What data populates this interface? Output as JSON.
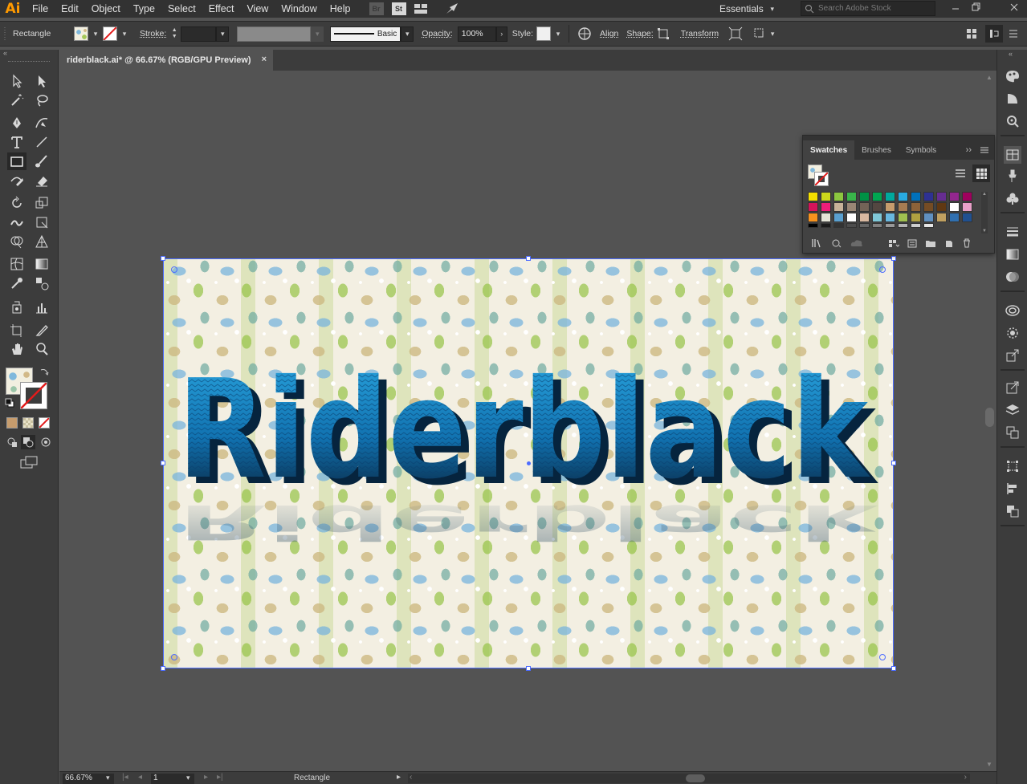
{
  "app": {
    "logo": "Ai"
  },
  "menu": [
    "File",
    "Edit",
    "Object",
    "Type",
    "Select",
    "Effect",
    "View",
    "Window",
    "Help"
  ],
  "menubar_icons": {
    "bridge": "Br",
    "stock": "St"
  },
  "workspace": {
    "label": "Essentials"
  },
  "search": {
    "placeholder": "Search Adobe Stock"
  },
  "controlbar": {
    "tool_name": "Rectangle",
    "stroke_label": "Stroke:",
    "stroke_value": "",
    "brush_label": "Basic",
    "opacity_label": "Opacity:",
    "opacity_value": "100%",
    "style_label": "Style:",
    "align_label": "Align",
    "shape_label": "Shape:",
    "transform_label": "Transform"
  },
  "document": {
    "tab_title": "riderblack.ai* @ 66.67% (RGB/GPU Preview)",
    "close": "×"
  },
  "artwork": {
    "headline": "Riderblack"
  },
  "swatches_panel": {
    "tabs": [
      "Swatches",
      "Brushes",
      "Symbols"
    ],
    "active_tab": "Swatches",
    "rows": [
      [
        "#f5e000",
        "#cdd81b",
        "#8cc63f",
        "#39b54a",
        "#009245",
        "#00a651",
        "#00a99d",
        "#29abe2",
        "#0071bc",
        "#2e3192",
        "#662d91",
        "#93278f",
        "#9e005d"
      ],
      [
        "#d4145a",
        "#ed1e79",
        "#c7b299",
        "#998675",
        "#736357",
        "#534741",
        "#c69c6d",
        "#a67c52",
        "#8c6239",
        "#754c24",
        "#603813",
        "#ffffff",
        "#e8a0c8"
      ],
      [
        "#f7931e",
        "#e5e5d8",
        "#5aa0d0",
        "#ffffff",
        "#d8b8a0",
        "#7fc8d8",
        "#68b8e0",
        "#a0c050",
        "#b0a040",
        "#6090c0",
        "#c0a060",
        "#3070b0",
        "#205090"
      ],
      [
        "#000000",
        "#1a1a1a",
        "#333333",
        "#4d4d4d",
        "#666666",
        "#808080",
        "#999999",
        "#b3b3b3",
        "#cccccc",
        "#e6e6e6"
      ]
    ]
  },
  "statusbar": {
    "zoom": "66.67%",
    "page": "1",
    "status": "Rectangle"
  },
  "colors": {
    "accent_selection": "#4d6cff",
    "artwork_text": "#1c8ec8"
  }
}
